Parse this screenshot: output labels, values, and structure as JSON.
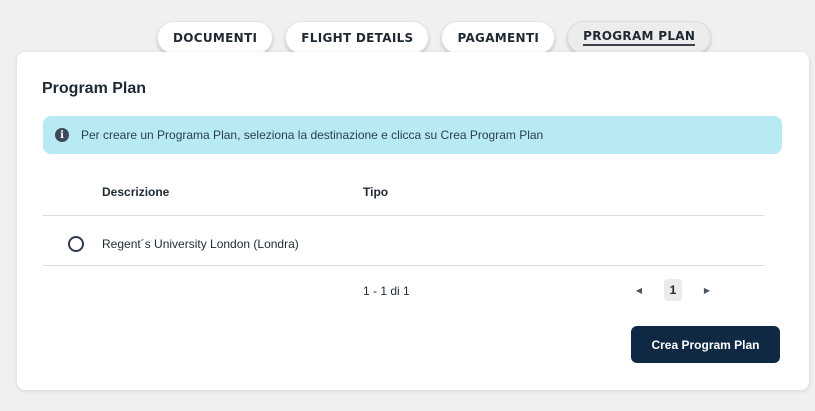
{
  "tabs": [
    {
      "label": "DOCUMENTI"
    },
    {
      "label": "FLIGHT DETAILS"
    },
    {
      "label": "PAGAMENTI"
    },
    {
      "label": "PROGRAM PLAN",
      "active": true
    }
  ],
  "section": {
    "title": "Program Plan",
    "info_icon": "info-icon",
    "info_text": "Per creare un Programa Plan, seleziona la destinazione e clicca su Crea Program Plan"
  },
  "table": {
    "headers": [
      "Descrizione",
      "Tipo"
    ],
    "rows": [
      {
        "descrizione": "Regent´s University London (Londra)",
        "tipo": "",
        "selected": false
      }
    ],
    "range": "1 - 1 di 1",
    "current_page": "1",
    "prev_icon": "caret-left-icon",
    "next_icon": "caret-right-icon"
  },
  "actions": {
    "create_label": "Crea Program Plan"
  },
  "colors": {
    "info_bg": "#b7eaf3",
    "button_bg": "#0f2945"
  }
}
